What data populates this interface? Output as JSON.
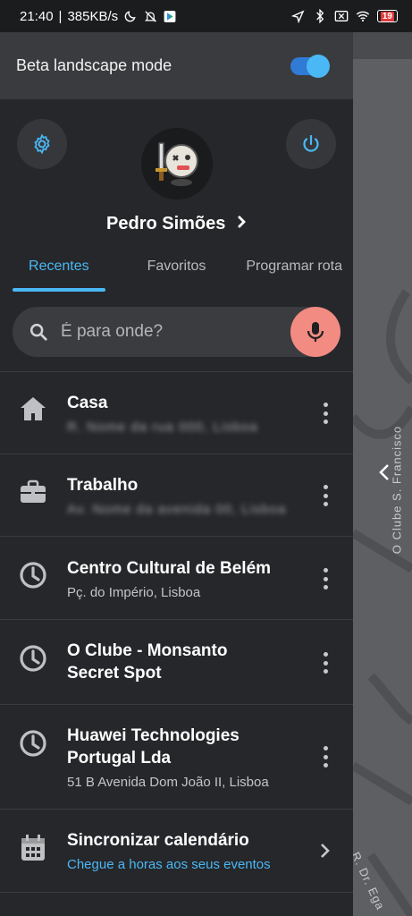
{
  "status_bar": {
    "time": "21:40",
    "speed": "385KB/s",
    "battery": "19",
    "icons": [
      "moon-icon",
      "bell-off-icon",
      "play-store-icon",
      "location-arrow-icon",
      "bluetooth-icon",
      "sim-off-icon",
      "wifi-icon",
      "battery-icon"
    ]
  },
  "beta": {
    "label": "Beta landscape mode",
    "enabled": true
  },
  "profile": {
    "name": "Pedro Simões",
    "settings_icon": "gear-icon",
    "power_icon": "power-icon"
  },
  "tabs": [
    {
      "label": "Recentes",
      "active": true
    },
    {
      "label": "Favoritos",
      "active": false
    },
    {
      "label": "Programar rota",
      "active": false
    }
  ],
  "search": {
    "placeholder": "É para onde?",
    "value": ""
  },
  "list": [
    {
      "icon": "home-icon",
      "title": "Casa",
      "subtitle": "R. Nome da rua 000, Lisboa",
      "blurred": true
    },
    {
      "icon": "briefcase-icon",
      "title": "Trabalho",
      "subtitle": "Av. Nome da avenida 00, Lisboa",
      "blurred": true
    },
    {
      "icon": "clock-icon",
      "title": "Centro Cultural de Belém",
      "subtitle": "Pç. do Império, Lisboa"
    },
    {
      "icon": "clock-icon",
      "title_line1": "O Clube - Monsanto",
      "title_line2": "Secret Spot"
    },
    {
      "icon": "clock-icon",
      "title_line1": "Huawei Technologies",
      "title_line2": "Portugal Lda",
      "subtitle": "51 B Avenida Dom João II, Lisboa"
    },
    {
      "icon": "calendar-icon",
      "title": "Sincronizar calendário",
      "subtitle": "Chegue a horas aos seus eventos"
    }
  ],
  "map": {
    "street1": "O Clube S. Francisco",
    "street2": "R. Dr. Ega"
  },
  "colors": {
    "accent": "#4ab8f5",
    "mic": "#f28b82",
    "drawer": "#26272a"
  }
}
